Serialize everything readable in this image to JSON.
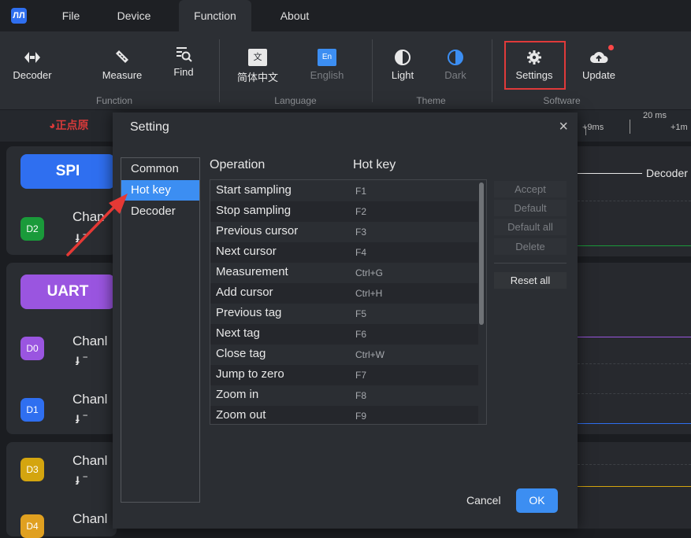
{
  "app": {
    "logo_text": "ЛЛ"
  },
  "menubar": {
    "items": [
      {
        "label": "File"
      },
      {
        "label": "Device"
      },
      {
        "label": "Function"
      },
      {
        "label": "About"
      }
    ]
  },
  "ribbon": {
    "function": {
      "decoder": "Decoder",
      "measure": "Measure",
      "find": "Find",
      "group": "Function"
    },
    "language": {
      "chinese": "简体中文",
      "english": "English",
      "group": "Language",
      "zh_glyph": "文",
      "en_glyph": "En"
    },
    "theme": {
      "light": "Light",
      "dark": "Dark",
      "group": "Theme"
    },
    "software": {
      "settings": "Settings",
      "update": "Update",
      "group": "Software"
    }
  },
  "toolbar_strip": {
    "brand": "正点原",
    "time_left": "+9ms",
    "time_mid": "20 ms",
    "time_right": "+1m"
  },
  "channels": {
    "spi": {
      "label": "SPI"
    },
    "uart": {
      "label": "UART"
    },
    "rows": [
      {
        "chip": "D2",
        "name": "Chan",
        "color": "#1a9a3a"
      },
      {
        "chip": "D0",
        "name": "Chanl",
        "color": "#9a55e0"
      },
      {
        "chip": "D1",
        "name": "Chanl",
        "color": "#2f6ff0"
      },
      {
        "chip": "D3",
        "name": "Chanl",
        "color": "#d4a50f"
      },
      {
        "chip": "D4",
        "name": "Chanl",
        "color": "#e0a020"
      }
    ],
    "edge_glyph": "ɟ ⁻"
  },
  "waveform": {
    "decoder_label": "Decoder"
  },
  "dialog": {
    "title": "Setting",
    "close": "×",
    "nav": [
      {
        "label": "Common"
      },
      {
        "label": "Hot key"
      },
      {
        "label": "Decoder"
      }
    ],
    "columns": {
      "operation": "Operation",
      "hotkey": "Hot key"
    },
    "hotkeys": [
      {
        "op": "Start sampling",
        "key": "F1"
      },
      {
        "op": "Stop sampling",
        "key": "F2"
      },
      {
        "op": "Previous cursor",
        "key": "F3"
      },
      {
        "op": "Next cursor",
        "key": "F4"
      },
      {
        "op": "Measurement",
        "key": "Ctrl+G"
      },
      {
        "op": "Add cursor",
        "key": "Ctrl+H"
      },
      {
        "op": "Previous tag",
        "key": "F5"
      },
      {
        "op": "Next tag",
        "key": "F6"
      },
      {
        "op": "Close tag",
        "key": "Ctrl+W"
      },
      {
        "op": "Jump to zero",
        "key": "F7"
      },
      {
        "op": "Zoom in",
        "key": "F8"
      },
      {
        "op": "Zoom out",
        "key": "F9"
      }
    ],
    "actions": {
      "accept": "Accept",
      "default": "Default",
      "default_all": "Default all",
      "delete": "Delete",
      "reset_all": "Reset all"
    },
    "footer": {
      "cancel": "Cancel",
      "ok": "OK"
    }
  },
  "colors": {
    "accent": "#3c8ef2",
    "highlight": "#e03a3a",
    "spi": "#2f6ff0",
    "uart": "#9a55e0"
  }
}
